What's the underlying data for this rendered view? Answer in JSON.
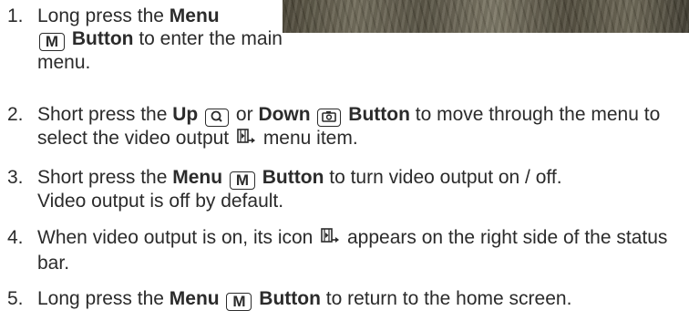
{
  "steps": [
    {
      "num": "1.",
      "parts": [
        "Long press the ",
        "Menu",
        " ",
        "M",
        " Button",
        " to enter the main menu."
      ]
    },
    {
      "num": "2.",
      "parts": [
        "Short press the ",
        "Up",
        " or ",
        "Down",
        " Button",
        " to move through the menu to select the video output ",
        " menu item."
      ]
    },
    {
      "num": "3.",
      "parts": [
        "Short press the ",
        "Menu",
        "M",
        " Button",
        " to turn video output on / off.",
        "Video output is off by default."
      ]
    },
    {
      "num": "4.",
      "parts": [
        "When video output is on, its icon ",
        " appears on the right side of the status bar."
      ]
    },
    {
      "num": "5.",
      "parts": [
        "Long press the ",
        "Menu",
        "M",
        " Button",
        " to return to the home screen."
      ]
    }
  ],
  "icons": {
    "up_button": "zoom-in-icon",
    "down_button": "camera-icon",
    "video_output": "video-output-icon"
  }
}
